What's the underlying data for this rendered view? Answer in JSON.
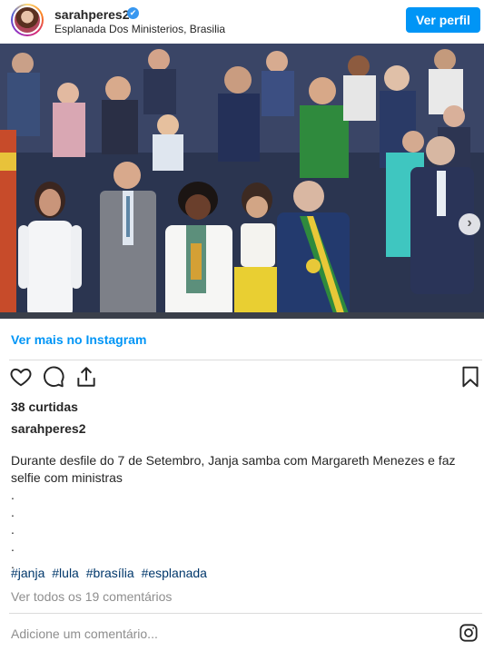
{
  "header": {
    "username": "sarahperes2",
    "verified_glyph": "✔",
    "location": "Esplanada Dos Ministerios, Brasilia",
    "profile_button": "Ver perfil"
  },
  "photo": {
    "next_glyph": "›",
    "carousel_count": 2,
    "carousel_active": 1
  },
  "post": {
    "see_more": "Ver mais no Instagram",
    "likes": "38 curtidas",
    "caption_user": "sarahperes2",
    "caption": "Durante desfile do 7 de Setembro, Janja samba com Margareth Menezes e faz selfie com ministras",
    "dot_lines": [
      ".",
      ".",
      ".",
      ".",
      "."
    ],
    "hashtags": [
      "#janja",
      "#lula",
      "#brasília",
      "#esplanada"
    ],
    "view_comments": "Ver todos os 19 comentários",
    "add_comment_placeholder": "Adicione um comentário..."
  },
  "icons": {
    "like": "heart-icon",
    "comment": "comment-icon",
    "share": "share-icon",
    "save": "bookmark-icon",
    "brand": "instagram-icon"
  },
  "colors": {
    "accent": "#0095f6",
    "link": "#00376b",
    "muted": "#8e8e8e",
    "text": "#262626"
  }
}
